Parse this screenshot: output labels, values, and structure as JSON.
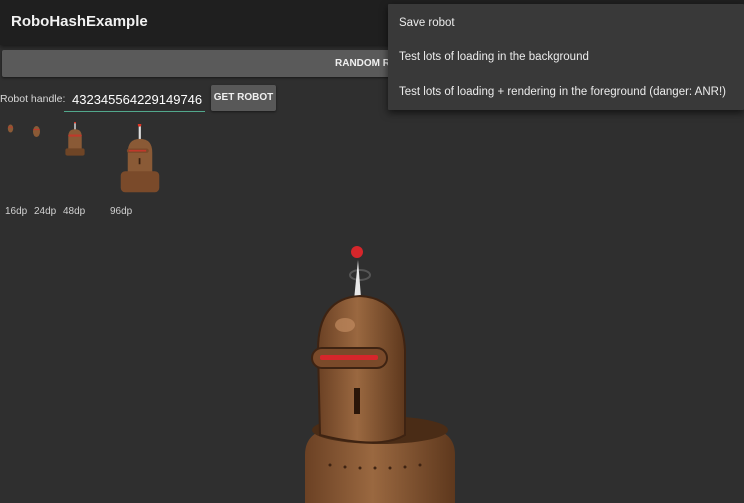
{
  "app": {
    "title": "RoboHashExample"
  },
  "random_button": {
    "label": "RANDOM RO"
  },
  "handle": {
    "label": "Robot handle:",
    "value": "432345564229149746"
  },
  "get_robot_button": {
    "label": "GET ROBOT"
  },
  "thumbnails": {
    "sizes": [
      "16dp",
      "24dp",
      "48dp",
      "96dp"
    ]
  },
  "overflow_menu": {
    "items": [
      "Save robot",
      "Test lots of loading in the background",
      "Test lots of loading + rendering in the foreground (danger: ANR!)"
    ]
  },
  "colors": {
    "background": "#2f2f2f",
    "appbar": "#1f1f1f",
    "accent": "#52a88c",
    "robot_body": "#8a5a36"
  },
  "icons": [
    "robot-image"
  ]
}
